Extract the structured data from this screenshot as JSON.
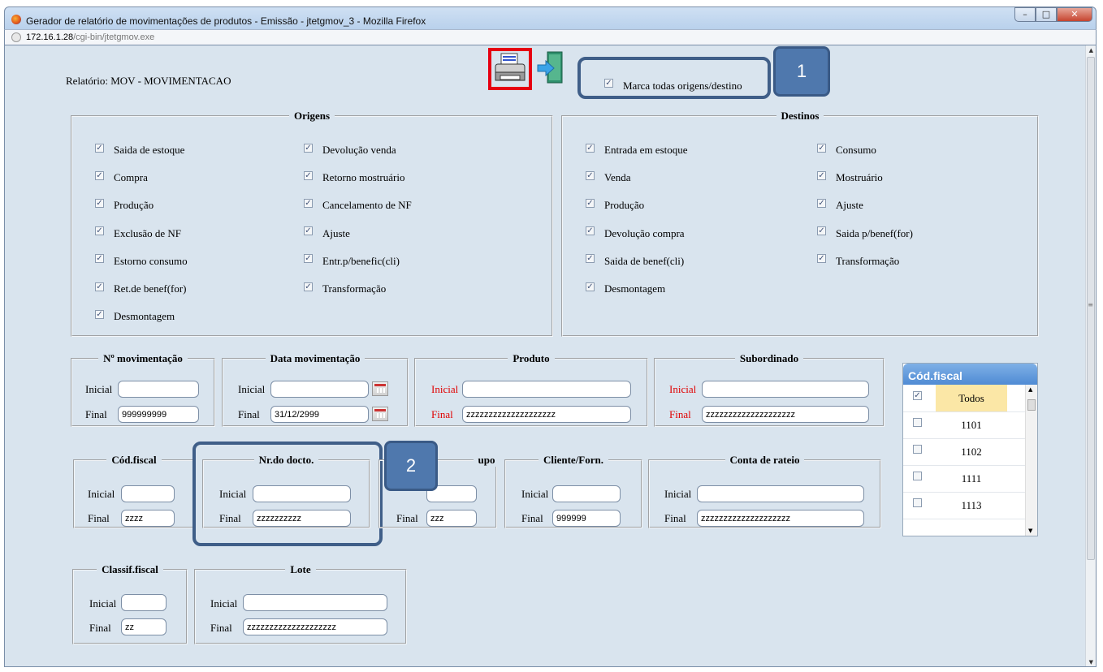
{
  "window": {
    "title": "Gerador de relatório de movimentações de produtos - Emissão - jtetgmov_3 - Mozilla Firefox",
    "url_host": "172.16.1.28",
    "url_path": "/cgi-bin/jtetgmov.exe"
  },
  "report_label": "Relatório:  MOV -  MOVIMENTACAO",
  "mark_all": {
    "label": "Marca todas origens/destino",
    "checked": true
  },
  "callouts": {
    "one": "1",
    "two": "2"
  },
  "origens": {
    "legend": "Origens",
    "col1": [
      "Saida de estoque",
      "Compra",
      "Produção",
      "Exclusão de NF",
      "Estorno consumo",
      "Ret.de benef(for)",
      "Desmontagem"
    ],
    "col2": [
      "Devolução venda",
      "Retorno mostruário",
      "Cancelamento de NF",
      "Ajuste",
      "Entr.p/benefic(cli)",
      "Transformação"
    ]
  },
  "destinos": {
    "legend": "Destinos",
    "col1": [
      "Entrada em estoque",
      "Venda",
      "Produção",
      "Devolução compra",
      "Saida de benef(cli)",
      "Desmontagem"
    ],
    "col2": [
      "Consumo",
      "Mostruário",
      "Ajuste",
      "Saida p/benef(for)",
      "Transformação"
    ]
  },
  "labels": {
    "inicial": "Inicial",
    "final": "Final"
  },
  "ranges": {
    "nr_mov": {
      "legend": "Nº movimentação",
      "inicial": "",
      "final": "999999999"
    },
    "data_mov": {
      "legend": "Data movimentação",
      "inicial": "",
      "final": "31/12/2999"
    },
    "produto": {
      "legend": "Produto",
      "inicial": "",
      "final": "zzzzzzzzzzzzzzzzzzzz"
    },
    "subordinado": {
      "legend": "Subordinado",
      "inicial": "",
      "final": "zzzzzzzzzzzzzzzzzzzz"
    },
    "cod_fiscal": {
      "legend": "Cód.fiscal",
      "inicial": "",
      "final": "zzzz"
    },
    "nr_docto": {
      "legend": "Nr.do docto.",
      "inicial": "",
      "final": "zzzzzzzzzz"
    },
    "grupo": {
      "legend": "upo",
      "inicial": "",
      "final": "zzz"
    },
    "cliente": {
      "legend": "Cliente/Forn.",
      "inicial": "",
      "final": "999999"
    },
    "conta_rateio": {
      "legend": "Conta de rateio",
      "inicial": "",
      "final": "zzzzzzzzzzzzzzzzzzzz"
    },
    "classif_fiscal": {
      "legend": "Classif.fiscal",
      "inicial": "",
      "final": "zz"
    },
    "lote": {
      "legend": "Lote",
      "inicial": "",
      "final": "zzzzzzzzzzzzzzzzzzzz"
    }
  },
  "cf_panel": {
    "title": "Cód.fiscal",
    "rows": [
      {
        "code": "Todos",
        "checked": true
      },
      {
        "code": "1101",
        "checked": false
      },
      {
        "code": "1102",
        "checked": false
      },
      {
        "code": "1111",
        "checked": false
      },
      {
        "code": "1113",
        "checked": false
      }
    ]
  },
  "colors": {
    "callout": "#3f5e88",
    "highlight": "#e60012",
    "content_bg": "#d9e4ee"
  }
}
